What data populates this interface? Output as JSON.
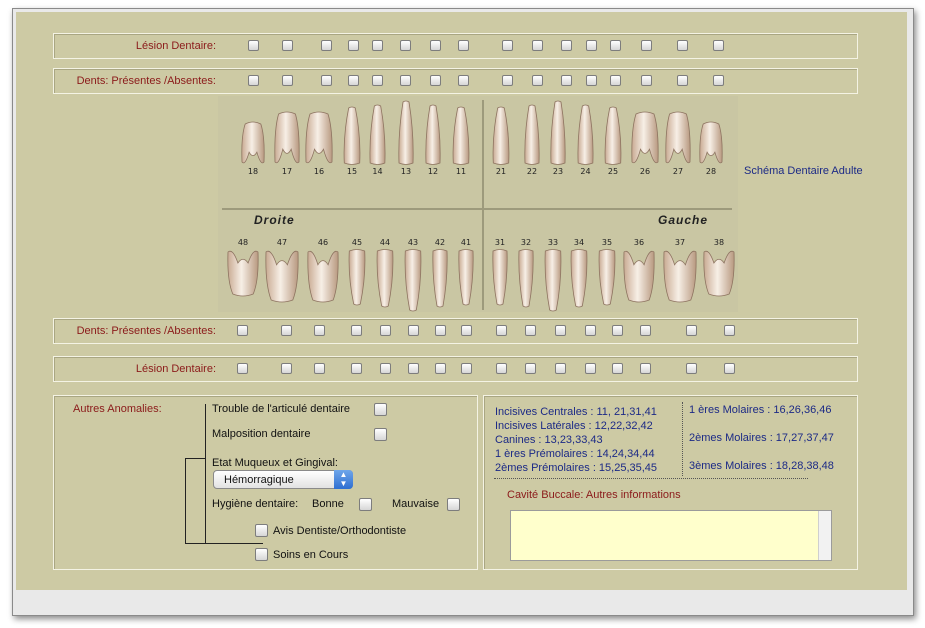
{
  "rows": {
    "lesion_top": {
      "label": "Lésion Dentaire:"
    },
    "presence_top": {
      "label": "Dents: Présentes /Absentes:"
    },
    "presence_bottom": {
      "label": "Dents: Présentes /Absentes:"
    },
    "lesion_bottom": {
      "label": "Lésion Dentaire:"
    }
  },
  "chart": {
    "upper_numbers": [
      "18",
      "17",
      "16",
      "15",
      "14",
      "13",
      "12",
      "11",
      "21",
      "22",
      "23",
      "24",
      "25",
      "26",
      "27",
      "28"
    ],
    "lower_numbers": [
      "48",
      "47",
      "46",
      "45",
      "44",
      "43",
      "42",
      "41",
      "31",
      "32",
      "33",
      "34",
      "35",
      "36",
      "37",
      "38"
    ],
    "right_label": "Droite",
    "left_label": "Gauche",
    "caption": "Schéma Dentaire Adulte"
  },
  "anomalies": {
    "title": "Autres Anomalies:",
    "trouble": "Trouble de l'articulé dentaire",
    "malposition": "Malposition dentaire",
    "etat": "Etat Muqueux et Gingival:",
    "etat_value": "Hémorragique",
    "hygiene": "Hygiène dentaire:",
    "bonne": "Bonne",
    "mauvaise": "Mauvaise",
    "avis": "Avis Dentiste/Orthodontiste",
    "soins": "Soins en Cours"
  },
  "legend": {
    "incisives_centrales": "Incisives Centrales : 11, 21,31,41",
    "incisives_laterales": "Incisives Latérales : 12,22,32,42",
    "canines": "Canines : 13,23,33,43",
    "premolaires1": "1 ères Prémolaires : 14,24,34,44",
    "premolaires2": "2èmes Prémolaires : 15,25,35,45",
    "molaires1": "1 ères Molaires : 16,26,36,46",
    "molaires2": "2èmes Molaires : 17,27,37,47",
    "molaires3": "3èmes Molaires : 18,28,38,48"
  },
  "cavite": {
    "label": "Cavité Buccale: Autres informations",
    "value": ""
  },
  "colors": {
    "panel": "#cdcaa4",
    "label_red": "#8b1a1a",
    "legend_blue": "#1c2a86",
    "notes_bg": "#ffffcc"
  }
}
